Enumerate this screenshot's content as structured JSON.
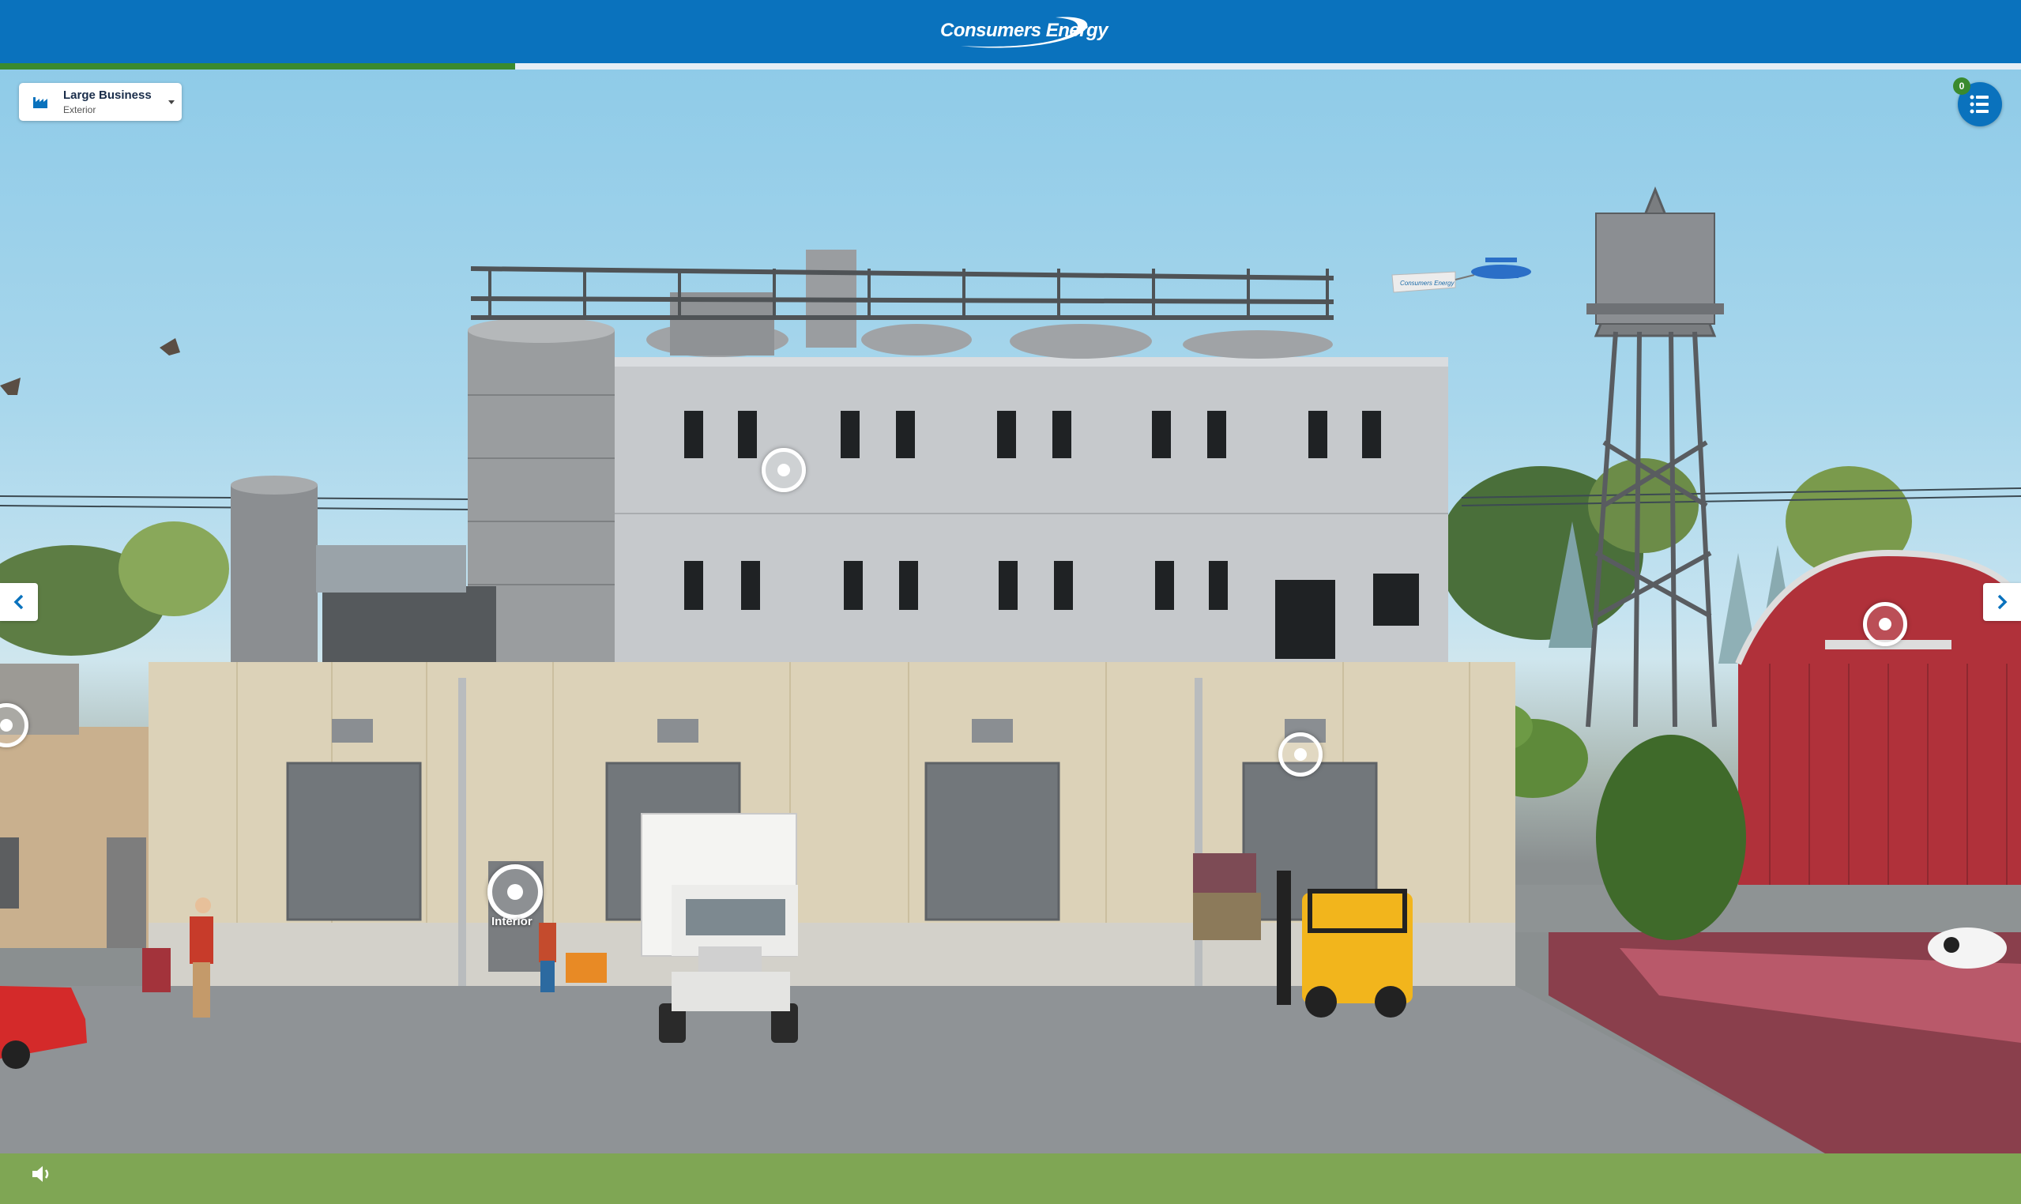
{
  "header": {
    "logo_text": "Consumers Energy",
    "progress": 0.255,
    "background_color": "#0a72bd",
    "progress_color": "#3a8a2e"
  },
  "location_selector": {
    "title": "Large Business",
    "subtitle": "Exterior",
    "icon": "factory-icon"
  },
  "list_button": {
    "icon": "list-icon",
    "badge_count": "0"
  },
  "navigation": {
    "left_icon": "chevron-left-icon",
    "right_icon": "chevron-right-icon"
  },
  "hotspots": {
    "interior_label": "Interior"
  },
  "sound": {
    "icon": "speaker-icon"
  },
  "scene": {
    "plane_banner_text": "Consumers Energy"
  }
}
